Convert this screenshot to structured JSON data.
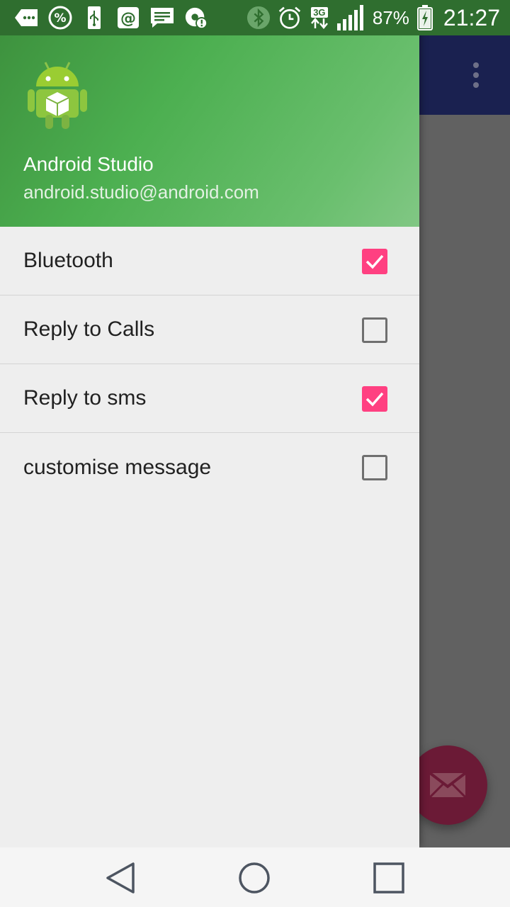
{
  "status_bar": {
    "battery_percent": "87%",
    "time": "21:27",
    "network_type": "3G",
    "left_icons": [
      "more-notifications-icon",
      "percent-icon",
      "usb-icon",
      "email-at-icon",
      "message-icon",
      "sync-alert-icon"
    ],
    "right_icons": [
      "bluetooth-icon",
      "alarm-icon",
      "network-3g-icon",
      "signal-icon",
      "battery-charging-icon"
    ]
  },
  "drawer": {
    "header": {
      "name": "Android Studio",
      "email": "android.studio@android.com",
      "avatar_icon": "android-robot-icon"
    },
    "items": [
      {
        "label": "Bluetooth",
        "checked": true
      },
      {
        "label": "Reply to Calls",
        "checked": false
      },
      {
        "label": "Reply to sms",
        "checked": true
      },
      {
        "label": "customise message",
        "checked": false
      }
    ]
  },
  "app": {
    "toolbar_color": "#1a2150",
    "fab_icon": "mail-icon"
  },
  "colors": {
    "header_green": "#4caf50",
    "accent_pink": "#ff4081",
    "status_bar_green": "#2f6e2f"
  },
  "nav_bar": {
    "buttons": [
      "back-icon",
      "home-icon",
      "recents-icon"
    ]
  }
}
